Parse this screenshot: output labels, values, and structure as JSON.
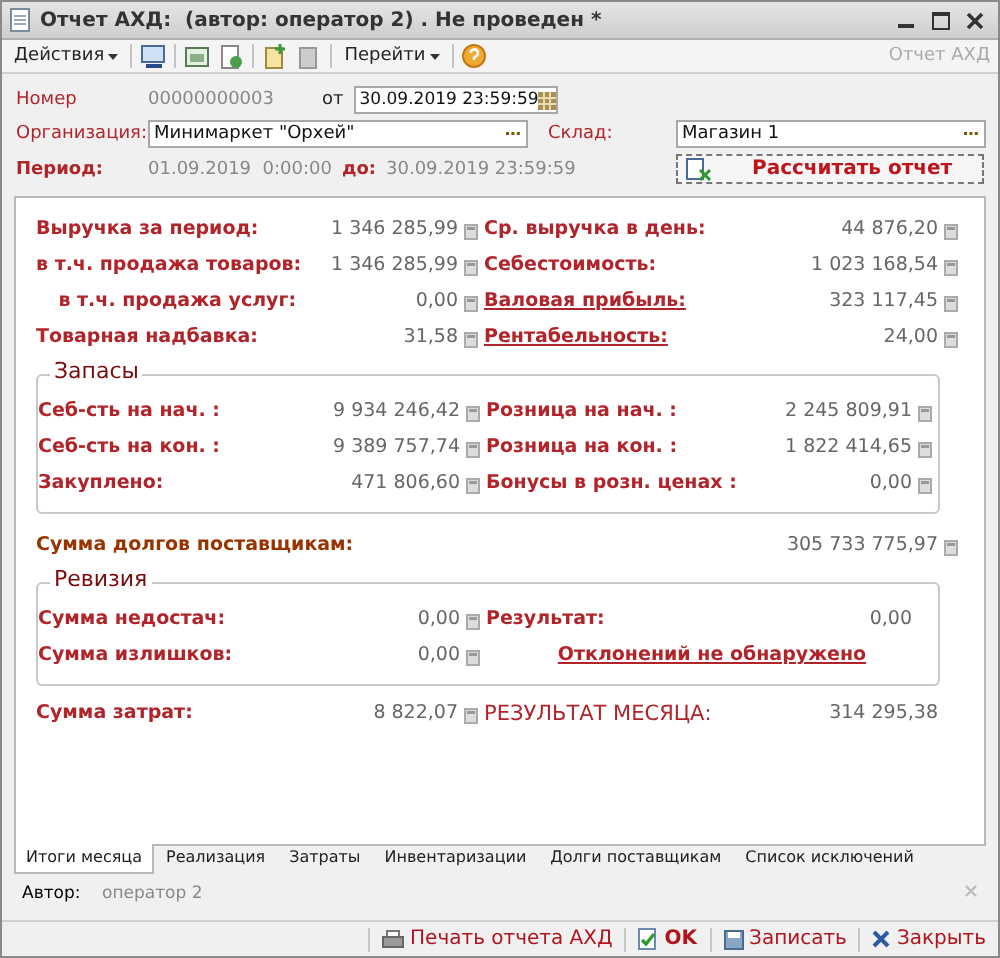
{
  "window": {
    "title": "Отчет АХД:  (автор: оператор 2) . Не проведен *"
  },
  "toolbar": {
    "actions_menu": "Действия",
    "goto_menu": "Перейти",
    "caption": "Отчет АХД"
  },
  "header": {
    "number": {
      "label": "Номер",
      "value": "00000000003"
    },
    "date": {
      "label": "от",
      "value": "30.09.2019 23:59:59"
    },
    "organization": {
      "label": "Организация:",
      "value": "Минимаркет \"Орхей\""
    },
    "warehouse": {
      "label": "Склад:",
      "value": "Магазин 1"
    },
    "period": {
      "label": "Период:",
      "from": "01.09.2019  0:00:00",
      "to_label": "до:",
      "to": "30.09.2019 23:59:59"
    },
    "calculate_button": "Рассчитать отчет"
  },
  "summary": [
    {
      "left": {
        "kind": "main",
        "label": "Выручка за период:",
        "value": "1 346 285,99"
      },
      "right": {
        "kind": "main",
        "label": "Ср. выручка в день:",
        "value": "44 876,20"
      }
    },
    {
      "left": {
        "kind": "sub",
        "label": "в т.ч. продажа товаров:",
        "value": "1 346 285,99"
      },
      "right": {
        "kind": "main",
        "label": "Себестоимость:",
        "value": "1 023 168,54"
      }
    },
    {
      "left": {
        "kind": "sub",
        "label": "в т.ч. продажа услуг:",
        "value": "0,00"
      },
      "right": {
        "kind": "link",
        "label": "Валовая прибыль:",
        "value": "323 117,45"
      }
    },
    {
      "left": {
        "kind": "main",
        "label": "Товарная надбавка:",
        "value": "31,58"
      },
      "right": {
        "kind": "link",
        "label": "Рентабельность:",
        "value": "24,00"
      }
    }
  ],
  "stock": {
    "title": "Запасы",
    "rows": [
      {
        "left": {
          "kind": "main",
          "label": "Себ-сть на нач. :",
          "value": "9 934 246,42"
        },
        "right": {
          "kind": "main",
          "label": "Розница на нач. :",
          "value": "2 245 809,91"
        }
      },
      {
        "left": {
          "kind": "main",
          "label": "Себ-сть на кон. :",
          "value": "9 389 757,74"
        },
        "right": {
          "kind": "main",
          "label": "Розница на кон. :",
          "value": "1 822 414,65"
        }
      },
      {
        "left": {
          "kind": "main",
          "label": "Закуплено:",
          "value": "471 806,60"
        },
        "right": {
          "kind": "main",
          "label": "Бонусы в розн. ценах :",
          "value": "0,00"
        }
      }
    ]
  },
  "supplier_debts": {
    "label": "Сумма долгов поставщикам:",
    "value": "305 733 775,97"
  },
  "revision": {
    "title": "Ревизия",
    "rows": [
      {
        "left": {
          "kind": "main",
          "label": "Сумма недостач:",
          "value": "0,00"
        },
        "right": {
          "kind": "plain",
          "label": "Результат:",
          "value": "0,00"
        }
      },
      {
        "left": {
          "kind": "main",
          "label": "Сумма излишков:",
          "value": "0,00"
        },
        "right": {
          "kind": "note",
          "label": "Отклонений не обнаружено"
        }
      }
    ]
  },
  "totals": {
    "left": {
      "kind": "main",
      "label": "Сумма затрат:",
      "value": "8 822,07"
    },
    "right": {
      "kind": "caps",
      "label": "РЕЗУЛЬТАТ МЕСЯЦА:",
      "value": "314 295,38"
    }
  },
  "tabs": [
    {
      "label": "Итоги месяца",
      "selected": true
    },
    {
      "label": "Реализация",
      "selected": false
    },
    {
      "label": "Затраты",
      "selected": false
    },
    {
      "label": "Инвентаризации",
      "selected": false
    },
    {
      "label": "Долги поставщикам",
      "selected": false
    },
    {
      "label": "Список исключений",
      "selected": false
    }
  ],
  "author": {
    "label": "Автор:",
    "value": "оператор 2"
  },
  "buttons": [
    {
      "kind": "print",
      "label": "Печать отчета АХД"
    },
    {
      "kind": "ok",
      "label": "OK"
    },
    {
      "kind": "save",
      "label": "Записать"
    },
    {
      "kind": "close",
      "label": "Закрыть"
    }
  ]
}
